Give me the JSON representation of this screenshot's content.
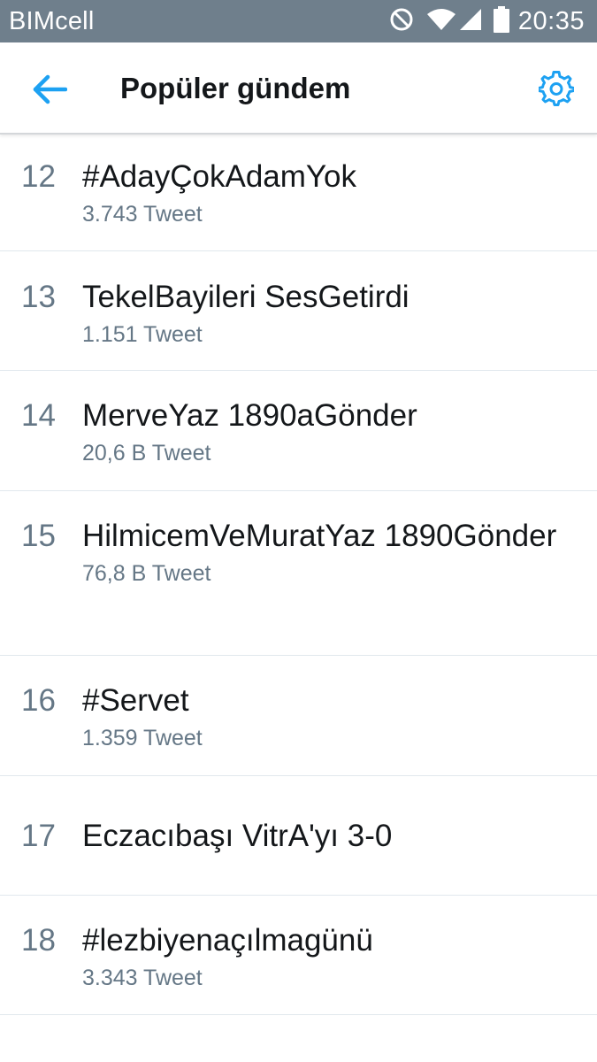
{
  "status_bar": {
    "carrier": "BIMcell",
    "time": "20:35",
    "icons": [
      "do-not-disturb-icon",
      "wifi-icon",
      "signal-icon",
      "battery-icon"
    ],
    "background": "#6f7f8c"
  },
  "header": {
    "back_icon": "arrow-left-icon",
    "title": "Popüler gündem",
    "settings_icon": "gear-icon",
    "accent": "#1da1f2"
  },
  "trends": [
    {
      "rank": "12",
      "name": "#AdayÇokAdamYok",
      "count": "3.743 Tweet"
    },
    {
      "rank": "13",
      "name": "TekelBayileri SesGetirdi",
      "count": "1.151 Tweet"
    },
    {
      "rank": "14",
      "name": "MerveYaz 1890aGönder",
      "count": "20,6 B Tweet"
    },
    {
      "rank": "15",
      "name": "HilmicemVeMuratYaz 1890Gönder",
      "count": "76,8 B Tweet"
    },
    {
      "rank": "16",
      "name": "#Servet",
      "count": "1.359 Tweet"
    },
    {
      "rank": "17",
      "name": "Eczacıbaşı VitrA'yı 3-0",
      "count": ""
    },
    {
      "rank": "18",
      "name": "#lezbiyenaçılmagünü",
      "count": "3.343 Tweet"
    }
  ]
}
